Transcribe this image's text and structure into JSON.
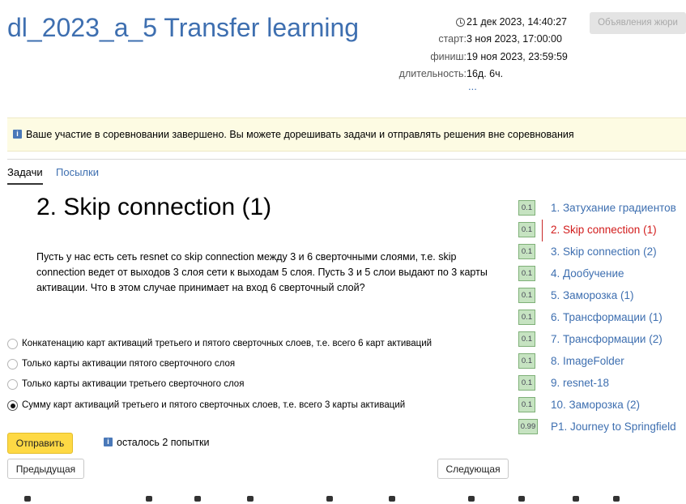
{
  "header": {
    "title": "dl_2023_a_5 Transfer learning",
    "jury_button": "Объявления жюри"
  },
  "contest_info": {
    "current_time": "21 дек 2023, 14:40:27",
    "start_label": "старт:",
    "start": "3 ноя 2023, 17:00:00",
    "finish_label": "финиш:",
    "finish": "19 ноя 2023, 23:59:59",
    "duration_label": "длительность:",
    "duration": "16д. 6ч.",
    "more": "..."
  },
  "notice": {
    "icon": "info-icon",
    "text": "Ваше участие в соревновании завершено. Вы можете дорешивать задачи и отправлять решения вне соревнования"
  },
  "tabs": [
    {
      "label": "Задачи",
      "active": true
    },
    {
      "label": "Посылки",
      "active": false
    }
  ],
  "problem": {
    "title": "2. Skip connection (1)",
    "statement": "Пусть у нас есть сеть resnet со skip connection между 3 и 6 сверточными слоями, т.е. skip connection ведет от выходов 3 слоя сети к выходам 5 слоя. Пусть 3 и 5 слои выдают по 3 карты активации. Что в этом случае принимает на вход 6 сверточный слой?",
    "options": [
      {
        "label": "Конкатенацию карт активаций третьего и пятого сверточных слоев, т.е. всего 6 карт активаций",
        "selected": false
      },
      {
        "label": "Только карты активации пятого сверточного слоя",
        "selected": false
      },
      {
        "label": "Только карты активации третьего сверточного слоя",
        "selected": false
      },
      {
        "label": "Сумму карт активаций третьего и пятого сверточных слоев, т.е. всего 3 карты активаций",
        "selected": true
      }
    ],
    "submit_label": "Отправить",
    "attempts_left": "осталось 2 попытки"
  },
  "navigation": {
    "prev_label": "Предыдущая",
    "next_label": "Следующая"
  },
  "problems_list": [
    {
      "score": "0.1",
      "name": "1. Затухание градиентов",
      "current": false
    },
    {
      "score": "0.1",
      "name": "2. Skip connection (1)",
      "current": true
    },
    {
      "score": "0.1",
      "name": "3. Skip connection (2)",
      "current": false
    },
    {
      "score": "0.1",
      "name": "4. Дообучение",
      "current": false
    },
    {
      "score": "0.1",
      "name": "5. Заморозка (1)",
      "current": false
    },
    {
      "score": "0.1",
      "name": "6. Трансформации (1)",
      "current": false
    },
    {
      "score": "0.1",
      "name": "7. Трансформации (2)",
      "current": false
    },
    {
      "score": "0.1",
      "name": "8. ImageFolder",
      "current": false
    },
    {
      "score": "0.1",
      "name": "9. resnet-18",
      "current": false
    },
    {
      "score": "0.1",
      "name": "10. Заморозка (2)",
      "current": false
    },
    {
      "score": "0.99",
      "name": "P1. Journey to Springfield",
      "current": false
    }
  ],
  "colors": {
    "link": "#3e6fb0",
    "current_problem": "#d21c1c",
    "submit_button": "#fed944",
    "notice_background": "#fdfbe3",
    "score_background": "#c6e3c1"
  }
}
